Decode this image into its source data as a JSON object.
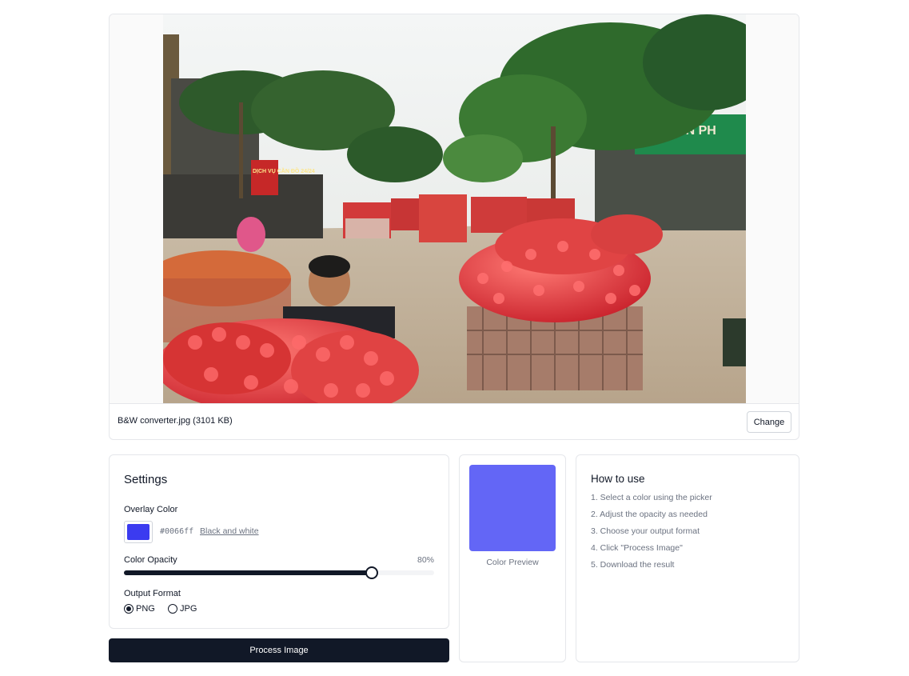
{
  "image": {
    "file_name": "B&W converter.jpg (3101 KB)",
    "change_label": "Change",
    "photo_sign_text": "DỊCH VỤ CẦN ĐỒ 24/24",
    "photo_shop_sign": "ỨA TIẾN PH"
  },
  "settings": {
    "title": "Settings",
    "overlay_label": "Overlay Color",
    "overlay_color": "#3b3bf0",
    "hex_value": "#0066ff",
    "bw_link": "Black and white",
    "opacity_label": "Color Opacity",
    "opacity_value": "80%",
    "opacity_fraction": 0.8,
    "format_label": "Output Format",
    "formats": [
      "PNG",
      "JPG"
    ],
    "selected_format": "PNG"
  },
  "process_label": "Process Image",
  "preview": {
    "label": "Color Preview",
    "color": "#6366f6"
  },
  "howto": {
    "title": "How to use",
    "steps": [
      "1. Select a color using the picker",
      "2. Adjust the opacity as needed",
      "3. Choose your output format",
      "4. Click \"Process Image\"",
      "5. Download the result"
    ]
  }
}
